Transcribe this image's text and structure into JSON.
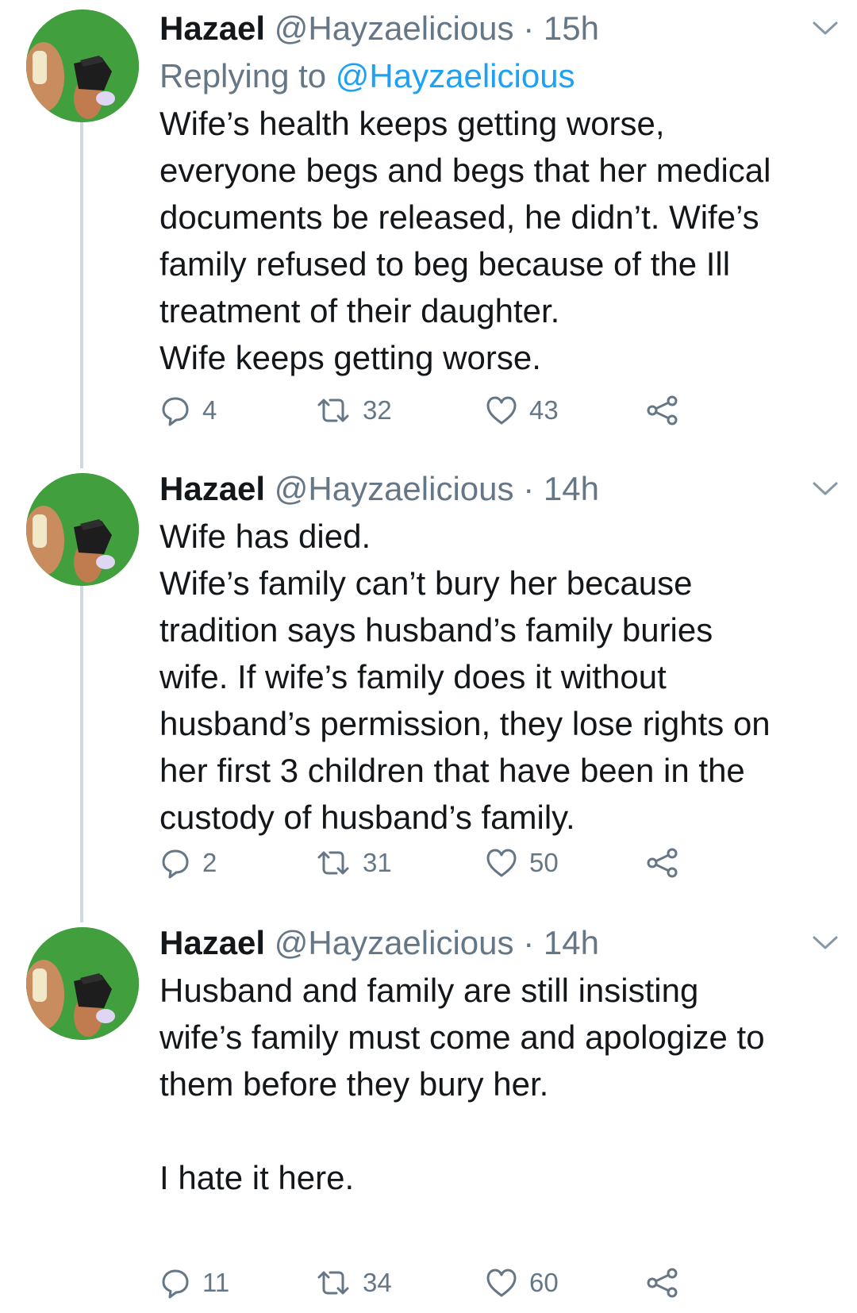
{
  "tweets": [
    {
      "name": "Hazael",
      "handle": "@Hayzaelicious",
      "separator": "·",
      "time": "15h",
      "replying_prefix": "Replying to",
      "replying_to": "@Hayzaelicious",
      "text": "Wife’s health keeps getting worse,\neveryone begs and begs that her medical\ndocuments be released, he didn’t. Wife’s\nfamily refused to beg because of the Ill\ntreatment of their daughter.\nWife keeps getting worse.",
      "replies": "4",
      "retweets": "32",
      "likes": "43"
    },
    {
      "name": "Hazael",
      "handle": "@Hayzaelicious",
      "separator": "·",
      "time": "14h",
      "text": "Wife has died.\nWife’s family can’t bury her because\ntradition says husband’s family buries\nwife. If wife’s family does it without\nhusband’s permission, they lose rights on\nher first 3 children that have been in the\ncustody of husband’s family.",
      "replies": "2",
      "retweets": "31",
      "likes": "50"
    },
    {
      "name": "Hazael",
      "handle": "@Hayzaelicious",
      "separator": "·",
      "time": "14h",
      "text": "Husband and family are still insisting\nwife’s family must come and apologize to\nthem before they bury her.\n\nI hate it here.",
      "replies": "11",
      "retweets": "34",
      "likes": "60"
    }
  ],
  "colors": {
    "text": "#14171a",
    "secondary": "#657786",
    "link": "#1da1f2",
    "thread_line": "#cfd9de"
  },
  "icons": {
    "reply": "speech-bubble-icon",
    "retweet": "retweet-arrows-icon",
    "like": "heart-outline-icon",
    "share": "share-nodes-icon",
    "menu": "chevron-down-icon"
  }
}
